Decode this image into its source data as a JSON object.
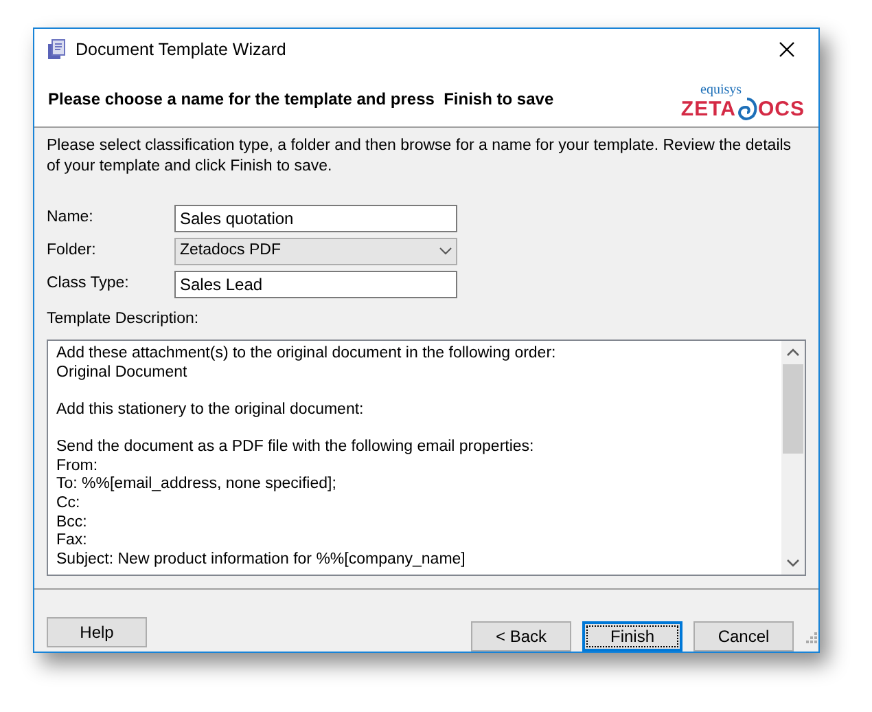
{
  "window": {
    "title": "Document Template Wizard"
  },
  "header": {
    "heading": "Please choose a name for the template and press  Finish to save",
    "logo": {
      "tagline": "equisys",
      "brand_start": "ZETA",
      "brand_end": "OCS"
    }
  },
  "intro": "Please select classification type, a folder and then browse for a name for your template. Review the details of your template and click Finish to save.",
  "fields": [
    {
      "kind": "text",
      "label": "Name:",
      "value": "Sales quotation"
    },
    {
      "kind": "dropdown",
      "label": "Folder:",
      "value": "Zetadocs PDF"
    },
    {
      "kind": "text",
      "label": "Class Type:",
      "value": "Sales Lead"
    }
  ],
  "description": {
    "label": "Template Description:",
    "paragraphs": [
      [
        "Add these attachment(s) to the original document in the following order:",
        "Original Document"
      ],
      [
        "Add this stationery to the original document:"
      ],
      [
        "Send the document as a PDF file with the following email properties:",
        "From:",
        "To: %%[email_address, none specified];",
        "Cc:",
        "Bcc:",
        "Fax:",
        "Subject: New product information for %%[company_name]"
      ]
    ]
  },
  "buttons": [
    {
      "label": "Help",
      "kind": "left",
      "default": false
    },
    {
      "label": "< Back",
      "kind": "right",
      "default": false
    },
    {
      "label": "Finish",
      "kind": "right",
      "default": true
    },
    {
      "label": "Cancel",
      "kind": "right",
      "default": false
    }
  ]
}
